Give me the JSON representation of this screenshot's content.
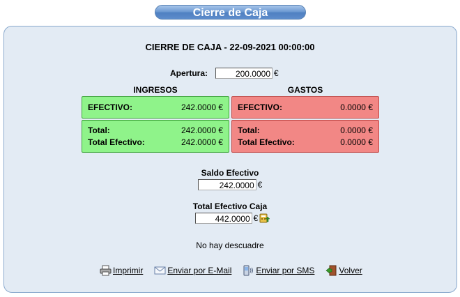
{
  "page_title": "Cierre de Caja",
  "heading": "CIERRE DE CAJA - 22-09-2021 00:00:00",
  "apertura": {
    "label": "Apertura:",
    "value": "200.0000",
    "currency": "€"
  },
  "ingresos": {
    "title": "INGRESOS",
    "efectivo_label": "EFECTIVO:",
    "efectivo_value": "242.0000 €",
    "total_label": "Total:",
    "total_value": "242.0000 €",
    "total_efectivo_label": "Total Efectivo:",
    "total_efectivo_value": "242.0000 €"
  },
  "gastos": {
    "title": "GASTOS",
    "efectivo_label": "EFECTIVO:",
    "efectivo_value": "0.0000 €",
    "total_label": "Total:",
    "total_value": "0.0000 €",
    "total_efectivo_label": "Total Efectivo:",
    "total_efectivo_value": "0.0000 €"
  },
  "saldo": {
    "label": "Saldo Efectivo",
    "value": "242.0000",
    "currency": "€"
  },
  "total_caja": {
    "label": "Total Efectivo Caja",
    "value": "442.0000",
    "currency": "€"
  },
  "status": "No hay descuadre",
  "actions": {
    "print": "Imprimir",
    "email": "Enviar por E-Mail",
    "sms": "Enviar por SMS",
    "back": "Volver"
  },
  "colors": {
    "ingresos_bg": "#8ff38a",
    "gastos_bg": "#f28785",
    "panel_bg": "#e3ebf4",
    "title_bg": "#5d8ccb"
  }
}
